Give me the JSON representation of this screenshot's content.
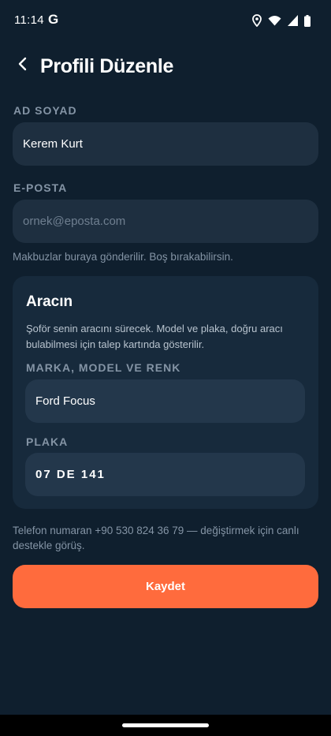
{
  "status_bar": {
    "time": "11:14",
    "g_logo": "G",
    "icons": [
      "location-icon",
      "wifi-icon",
      "signal-icon",
      "battery-icon"
    ]
  },
  "header": {
    "title": "Profili Düzenle",
    "back_icon": "back-arrow-icon"
  },
  "name_field": {
    "label": "AD SOYAD",
    "value": "Kerem Kurt"
  },
  "email_field": {
    "label": "E-POSTA",
    "placeholder": "ornek@eposta.com",
    "helper": "Makbuzlar buraya gönderilir. Boş bırakabilirsin."
  },
  "vehicle_card": {
    "title": "Aracın",
    "description": "Şoför senin aracını sürecek. Model ve plaka, doğru aracı bulabilmesi için talep kartında gösterilir.",
    "model_field": {
      "label": "MARKA, MODEL VE RENK",
      "value": "Ford Focus"
    },
    "plate_field": {
      "label": "PLAKA",
      "value": "07 DE 141"
    }
  },
  "phone_note": "Telefon numaran +90 530 824 36 79 — değiştirmek için canlı destekle görüş.",
  "save_button": {
    "label": "Kaydet"
  },
  "colors": {
    "background": "#0f1f2e",
    "input": "#1e2f40",
    "card": "#172a3c",
    "accent": "#ff6b3d",
    "muted_text": "#8494a5"
  }
}
